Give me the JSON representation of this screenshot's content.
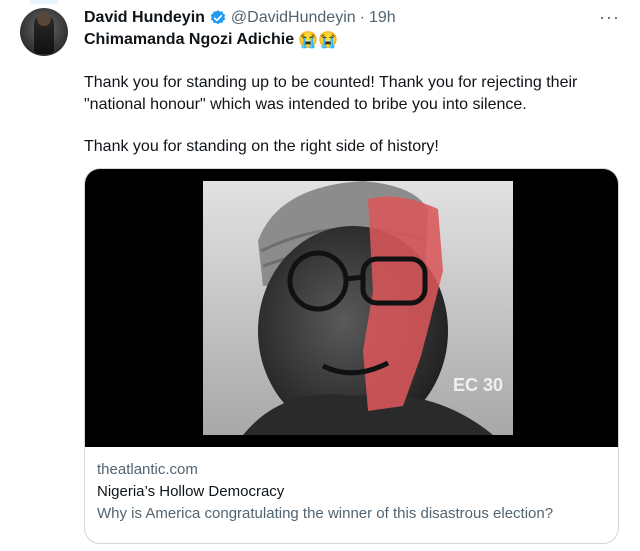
{
  "tweet": {
    "author_name": "David Hundeyin",
    "handle": "@DavidHundeyin",
    "separator": "·",
    "time": "19h",
    "more_label": "···",
    "first_line": "Chimamanda Ngozi Adichie",
    "first_line_emoji": "😭😭",
    "paragraphs": [
      "Thank you for standing up to be counted! Thank you for rejecting their \"national honour\" which was intended to bribe you into silence.",
      "Thank you for standing on the right side of history!"
    ]
  },
  "card": {
    "domain": "theatlantic.com",
    "title": "Nigeria’s Hollow Democracy",
    "description": "Why is America congratulating the winner of this disastrous election?",
    "image_badge": "EC 30"
  },
  "colors": {
    "verified": "#1d9bf0",
    "secondary_text": "#536471",
    "card_border": "#cfd9de",
    "red_overlay": "#d9575a"
  }
}
